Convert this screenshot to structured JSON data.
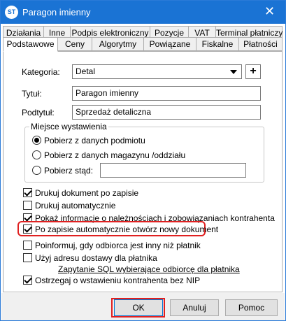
{
  "window": {
    "title": "Paragon imienny",
    "app_icon_text": "ST",
    "close_glyph": "✕"
  },
  "tabs_row_top": [
    "Działania",
    "Inne",
    "Podpis elektroniczny",
    "Pozycje",
    "VAT",
    "Terminal płatniczy"
  ],
  "tabs_row_bottom": [
    "Podstawowe",
    "Ceny",
    "Algorytmy",
    "Powiązane",
    "Fiskalne",
    "Płatności"
  ],
  "active_tab": "Podstawowe",
  "form": {
    "kategoria_label": "Kategoria:",
    "kategoria_value": "Detal",
    "plus_glyph": "+",
    "tytul_label": "Tytuł:",
    "tytul_value": "Paragon imienny",
    "podtytul_label": "Podtytuł:",
    "podtytul_value": "Sprzedaż detaliczna"
  },
  "miejsce": {
    "legend": "Miejsce wystawienia",
    "options": [
      {
        "label": "Pobierz z danych podmiotu",
        "selected": true
      },
      {
        "label": "Pobierz z danych magazynu /oddziału",
        "selected": false
      },
      {
        "label": "Pobierz stąd:",
        "selected": false
      }
    ],
    "stad_value": ""
  },
  "checkboxes_a": [
    {
      "label": "Drukuj dokument po zapisie",
      "checked": true
    },
    {
      "label": "Drukuj automatycznie",
      "checked": false
    },
    {
      "label": "Pokaż informacje o należnościach i zobowiązaniach kontrahenta",
      "checked": true
    },
    {
      "label": "Po zapisie automatycznie otwórz nowy dokument",
      "checked": true,
      "highlighted": true
    }
  ],
  "checkboxes_b": [
    {
      "label": "Poinformuj, gdy odbiorca jest inny niż płatnik",
      "checked": false
    },
    {
      "label": "Użyj adresu dostawy dla płatnika",
      "checked": false
    }
  ],
  "sql_link": "Zapytanie SQL wybierające odbiorcę dla płatnika",
  "checkbox_nip": {
    "label": "Ostrzegaj o wstawieniu kontrahenta bez NIP",
    "checked": true
  },
  "buttons": {
    "ok": "OK",
    "cancel": "Anuluj",
    "help": "Pomoc"
  },
  "colors": {
    "titlebar": "#1a73d4",
    "highlight": "#e02020"
  }
}
